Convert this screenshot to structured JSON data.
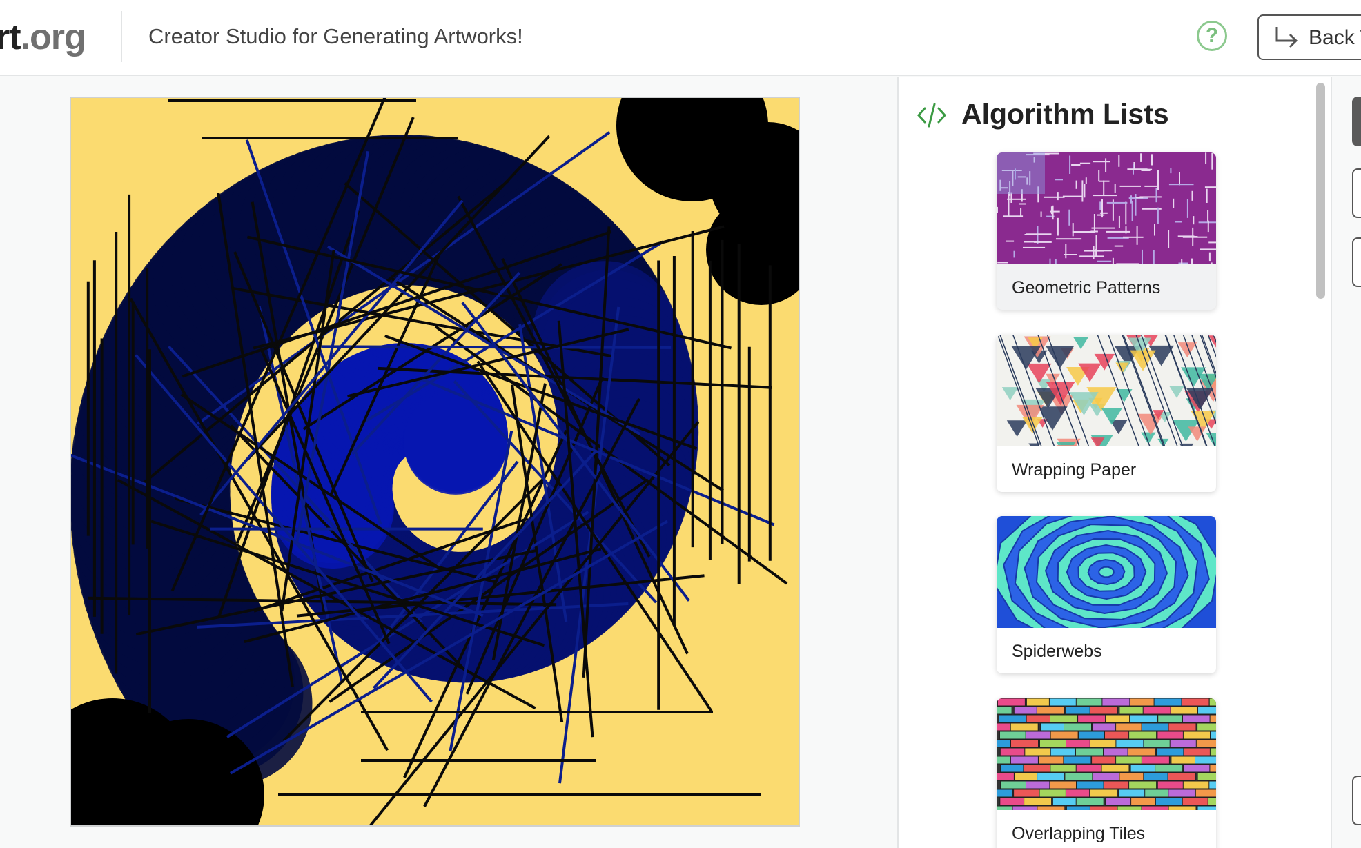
{
  "header": {
    "logo_main": "rt",
    "logo_suffix": ".org",
    "subtitle": "Creator Studio for Generating Artworks!",
    "help_symbol": "?",
    "back_label": "Back T"
  },
  "canvas": {
    "background": "#fbdb70",
    "ribbon_colors": [
      "#020a3e",
      "#05116f",
      "#0716b0"
    ],
    "line_color": "#0a0a0a"
  },
  "panel": {
    "title": "Algorithm Lists",
    "icon": "code-icon",
    "accent": "#3b9a43",
    "algorithms": [
      {
        "label": "Geometric Patterns",
        "thumb": "purple-maze"
      },
      {
        "label": "Wrapping Paper",
        "thumb": "colorful-triangles"
      },
      {
        "label": "Spiderwebs",
        "thumb": "blue-web"
      },
      {
        "label": "Overlapping Tiles",
        "thumb": "rainbow-bricks"
      }
    ]
  },
  "icons": [
    "help-icon",
    "back-arrow-icon",
    "code-icon"
  ]
}
